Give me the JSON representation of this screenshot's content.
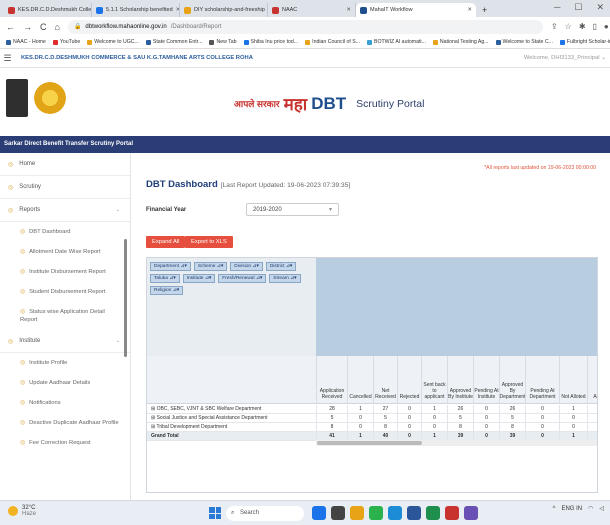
{
  "browser": {
    "tabs": [
      {
        "label": "KES.DR.C.D.Deshmukh College Roha",
        "color": "#c8332f",
        "active": false
      },
      {
        "label": "5.1.1 Scholarship benefited",
        "color": "#1a73e8",
        "active": false
      },
      {
        "label": "DIY scholarship-and-freeship",
        "color": "#e8a317",
        "active": false
      },
      {
        "label": "NAAC",
        "color": "#c8332f",
        "active": false
      },
      {
        "label": "MahaIT Workflow",
        "color": "#1f4e8c",
        "active": true
      }
    ],
    "new_tab": "+",
    "url_host": "dbtworkflow.mahaonline.gov.in",
    "url_path": "/Dashboard/Report",
    "bookmarks": [
      {
        "label": "NAAC - Home",
        "color": "#2c5e9e"
      },
      {
        "label": "YouTube",
        "color": "#e02a2a"
      },
      {
        "label": "Welcome to UGC...",
        "color": "#e8a317"
      },
      {
        "label": "State Common Entr...",
        "color": "#2c5e9e"
      },
      {
        "label": "New Tab",
        "color": "#555555"
      },
      {
        "label": "Shiba Inu price tod...",
        "color": "#1a73e8"
      },
      {
        "label": "Indian Council of S...",
        "color": "#e8a317"
      },
      {
        "label": "BOTWIZ AI automati...",
        "color": "#3aa0d6"
      },
      {
        "label": "National Testing Ag...",
        "color": "#e8a317"
      },
      {
        "label": "Welcome to State C...",
        "color": "#2c5e9e"
      },
      {
        "label": "Fulbright Scholar-in...",
        "color": "#1a73e8"
      }
    ]
  },
  "header": {
    "college": "KES.DR.C.D.DESHMUKH COMMERCE & SAU K.G.TAMHANE ARTS COLLEGE ROHA",
    "welcome": "Welcome, DHI3133_Principal",
    "brand_aaple": "आपले सरकार",
    "brand_maha": "महा",
    "brand_dbt": "DBT",
    "portal": "Scrutiny Portal",
    "bluebar": "Sarkar Direct Benefit Transfer Scrutiny Portal"
  },
  "sidebar": {
    "items": [
      {
        "label": "Home",
        "type": "item"
      },
      {
        "label": "Scrutiny",
        "type": "item"
      },
      {
        "label": "Reports",
        "type": "group"
      },
      {
        "label": "DBT Dashboard",
        "type": "sub"
      },
      {
        "label": "Allotment Date Wise Report",
        "type": "sub"
      },
      {
        "label": "Institute Disbursement Report",
        "type": "sub"
      },
      {
        "label": "Student Disbursement Report",
        "type": "sub"
      },
      {
        "label": "Status wise Application Detail Report",
        "type": "sub"
      },
      {
        "label": "Institute",
        "type": "group"
      },
      {
        "label": "Institute Profile",
        "type": "sub"
      },
      {
        "label": "Update Aadhaar Details",
        "type": "sub"
      },
      {
        "label": "Notifications",
        "type": "sub"
      },
      {
        "label": "Deactive Duplicate Aadhaar Profile",
        "type": "sub"
      },
      {
        "label": "Fee Correction Request",
        "type": "sub"
      }
    ]
  },
  "main": {
    "note": "*All reports last updated on 19-06-2023 00:00:00",
    "title": "DBT Dashboard",
    "last_updated": "[Last Report Updated: 19-06-2023 07:39:35]",
    "fy_label": "Financial Year",
    "fy_value": "2019-2020",
    "expand_all": "Expand All",
    "export": "Export to XLS",
    "filter_chips": [
      "Department",
      "Scheme",
      "Division",
      "District",
      "Taluka",
      "Institute",
      "Fresh/Renewal",
      "Stream",
      "Religion"
    ],
    "columns": [
      "Application Received",
      "Cancelled",
      "Net Received",
      "Rejected",
      "Sent back to applicant",
      "Approved By Institute",
      "Pending At Institute",
      "Approved By Department",
      "Pending At Department",
      "Not Alloted",
      "Allo"
    ],
    "rows": [
      {
        "name": "⊞ OBC, SEBC, VJNT & SBC Welfare Department",
        "values": [
          "28",
          "1",
          "27",
          "0",
          "1",
          "26",
          "0",
          "26",
          "0",
          "1",
          ""
        ]
      },
      {
        "name": "⊞ Social Justice and Special Assistance Department",
        "values": [
          "5",
          "0",
          "5",
          "0",
          "0",
          "5",
          "0",
          "5",
          "0",
          "0",
          ""
        ]
      },
      {
        "name": "⊞ Tribal Development Department",
        "values": [
          "8",
          "0",
          "8",
          "0",
          "0",
          "8",
          "0",
          "8",
          "0",
          "0",
          ""
        ]
      },
      {
        "name": "Grand Total",
        "values": [
          "41",
          "1",
          "40",
          "0",
          "1",
          "39",
          "0",
          "39",
          "0",
          "1",
          ""
        ]
      }
    ]
  },
  "taskbar": {
    "temp": "32°C",
    "weather": "Haze",
    "search": "Search",
    "lang": "ENG IN"
  }
}
